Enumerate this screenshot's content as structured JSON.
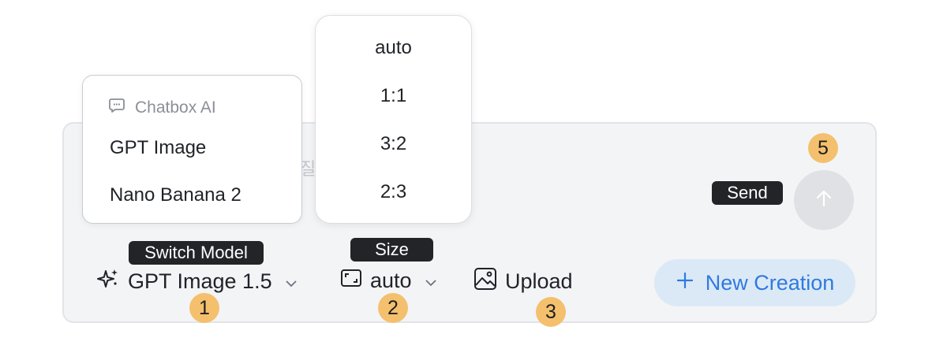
{
  "model_menu": {
    "header": "Chatbox AI",
    "items": [
      "GPT Image",
      "Nano Banana 2"
    ]
  },
  "size_menu": {
    "options": [
      "auto",
      "1:1",
      "3:2",
      "2:3"
    ]
  },
  "tooltips": {
    "switch_model": "Switch Model",
    "size": "Size",
    "send": "Send"
  },
  "toolbar": {
    "model_label": "GPT Image 1.5",
    "size_label": "auto",
    "upload_label": "Upload",
    "new_creation_label": "New Creation"
  },
  "input": {
    "ghost_text": "질"
  },
  "badges": [
    "1",
    "2",
    "3",
    "5"
  ],
  "colors": {
    "badge": "#f4c06d",
    "accent": "#2f7ae0",
    "new_button_bg": "#dbe9f7",
    "tooltip_bg": "#222428"
  },
  "icons": {
    "model": "sparkles-icon",
    "size": "aspect-ratio-icon",
    "upload": "image-icon",
    "send": "arrow-up-icon",
    "new": "plus-icon",
    "menu_header": "chat-bubble-icon"
  }
}
